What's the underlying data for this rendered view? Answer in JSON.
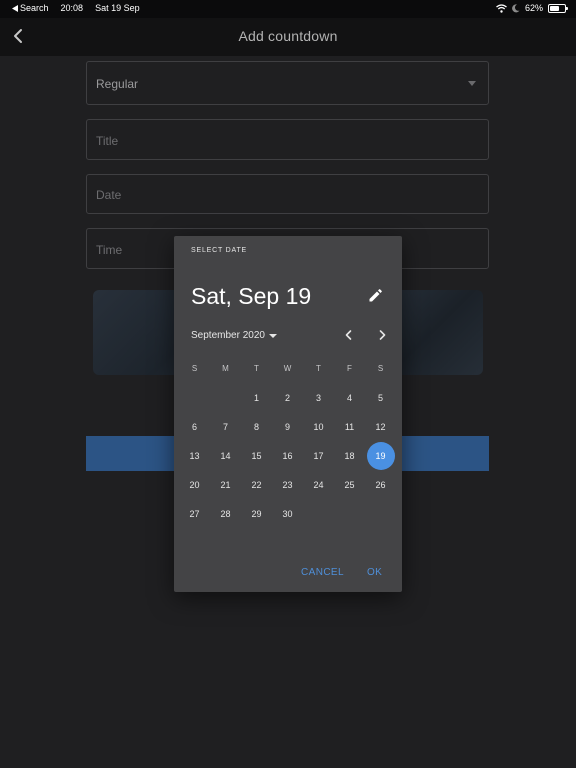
{
  "status_bar": {
    "back_app": "Search",
    "time": "20:08",
    "date": "Sat 19 Sep",
    "battery": "62%",
    "battery_level": 0.62
  },
  "app_bar": {
    "title": "Add countdown",
    "back_icon": "chevron-left-icon"
  },
  "form": {
    "type_value": "Regular",
    "title_placeholder": "Title",
    "date_placeholder": "Date",
    "time_placeholder": "Time"
  },
  "date_picker": {
    "help_text": "SELECT DATE",
    "headline": "Sat, Sep 19",
    "month_label": "September 2020",
    "weekday_headers": [
      "S",
      "M",
      "T",
      "W",
      "T",
      "F",
      "S"
    ],
    "weeks": [
      [
        "",
        "",
        "1",
        "2",
        "3",
        "4",
        "5"
      ],
      [
        "6",
        "7",
        "8",
        "9",
        "10",
        "11",
        "12"
      ],
      [
        "13",
        "14",
        "15",
        "16",
        "17",
        "18",
        "19"
      ],
      [
        "20",
        "21",
        "22",
        "23",
        "24",
        "25",
        "26"
      ],
      [
        "27",
        "28",
        "29",
        "30",
        "",
        "",
        ""
      ]
    ],
    "selected_day": "19",
    "accent_color": "#4a90e2",
    "cancel_label": "CANCEL",
    "ok_label": "OK"
  }
}
